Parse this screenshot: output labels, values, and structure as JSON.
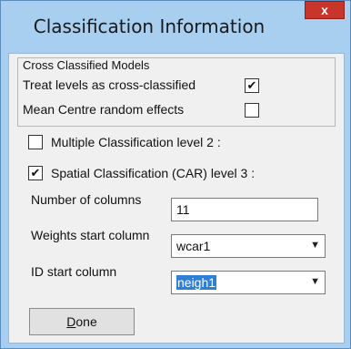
{
  "window": {
    "title": "Classification Information",
    "close_glyph": "x"
  },
  "cross_group": {
    "legend": "Cross Classified Models",
    "treat_levels": {
      "label": "Treat levels as cross-classified",
      "checked": true
    },
    "mean_centre": {
      "label": "Mean Centre random effects",
      "checked": false
    }
  },
  "multiple_classification": {
    "label": "Multiple Classification level 2 :",
    "checked": false
  },
  "spatial_classification": {
    "label": "Spatial Classification (CAR) level 3 :",
    "checked": true
  },
  "number_of_columns": {
    "label": "Number of columns",
    "value": "11"
  },
  "weights_start_column": {
    "label": "Weights start column",
    "value": "wcar1"
  },
  "id_start_column": {
    "label": "ID start column",
    "value": "neigh1"
  },
  "done_button": {
    "underlined": "D",
    "rest": "one"
  },
  "glyphs": {
    "check": "✔",
    "dropdown": "▼"
  }
}
